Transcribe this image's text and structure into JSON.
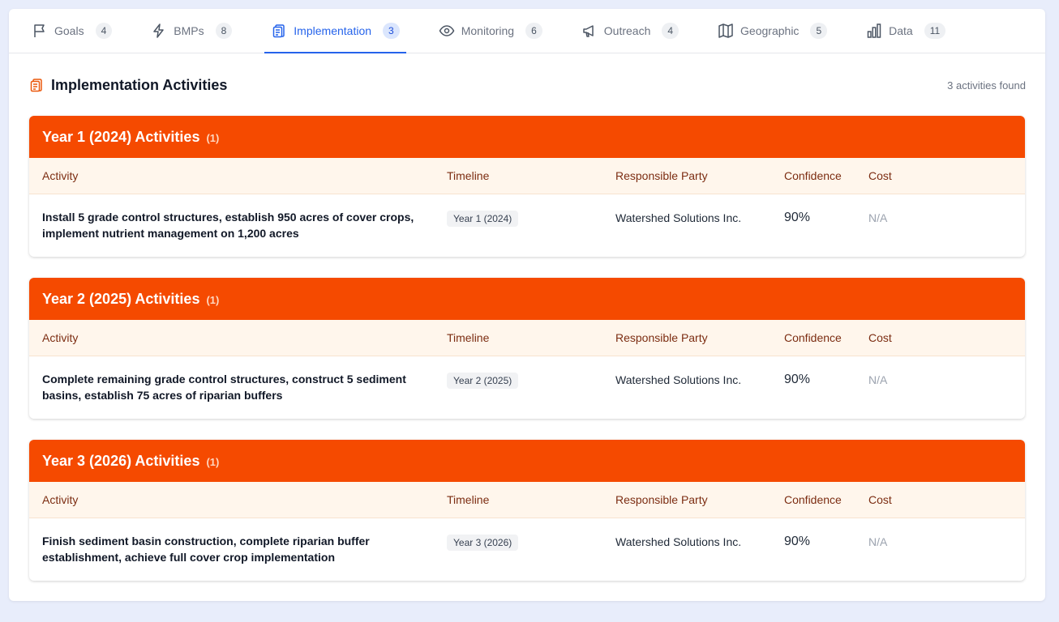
{
  "tabs": [
    {
      "label": "Goals",
      "count": "4",
      "icon": "flag-icon"
    },
    {
      "label": "BMPs",
      "count": "8",
      "icon": "lightning-icon"
    },
    {
      "label": "Implementation",
      "count": "3",
      "icon": "clipboard-icon"
    },
    {
      "label": "Monitoring",
      "count": "6",
      "icon": "eye-icon"
    },
    {
      "label": "Outreach",
      "count": "4",
      "icon": "megaphone-icon"
    },
    {
      "label": "Geographic",
      "count": "5",
      "icon": "map-icon"
    },
    {
      "label": "Data",
      "count": "11",
      "icon": "bar-chart-icon"
    }
  ],
  "active_tab": "Implementation",
  "section": {
    "title": "Implementation Activities",
    "count_text": "3 activities found",
    "icon": "clipboard-icon"
  },
  "columns": [
    "Activity",
    "Timeline",
    "Responsible Party",
    "Confidence",
    "Cost"
  ],
  "years": [
    {
      "title": "Year 1 (2024) Activities",
      "count": "(1)",
      "activity": "Install 5 grade control structures, establish 950 acres of cover crops, implement nutrient management on 1,200 acres",
      "timeline": "Year 1 (2024)",
      "party": "Watershed Solutions Inc.",
      "confidence": "90%",
      "cost": "N/A"
    },
    {
      "title": "Year 2 (2025) Activities",
      "count": "(1)",
      "activity": "Complete remaining grade control structures, construct 5 sediment basins, establish 75 acres of riparian buffers",
      "timeline": "Year 2 (2025)",
      "party": "Watershed Solutions Inc.",
      "confidence": "90%",
      "cost": "N/A"
    },
    {
      "title": "Year 3 (2026) Activities",
      "count": "(1)",
      "activity": "Finish sediment basin construction, complete riparian buffer establishment, achieve full cover crop implementation",
      "timeline": "Year 3 (2026)",
      "party": "Watershed Solutions Inc.",
      "confidence": "90%",
      "cost": "N/A"
    }
  ],
  "colors": {
    "accent": "#2563eb",
    "year_header": "#f54a00",
    "column_header_bg": "#fff6ec",
    "column_header_text": "#7c2d12"
  }
}
